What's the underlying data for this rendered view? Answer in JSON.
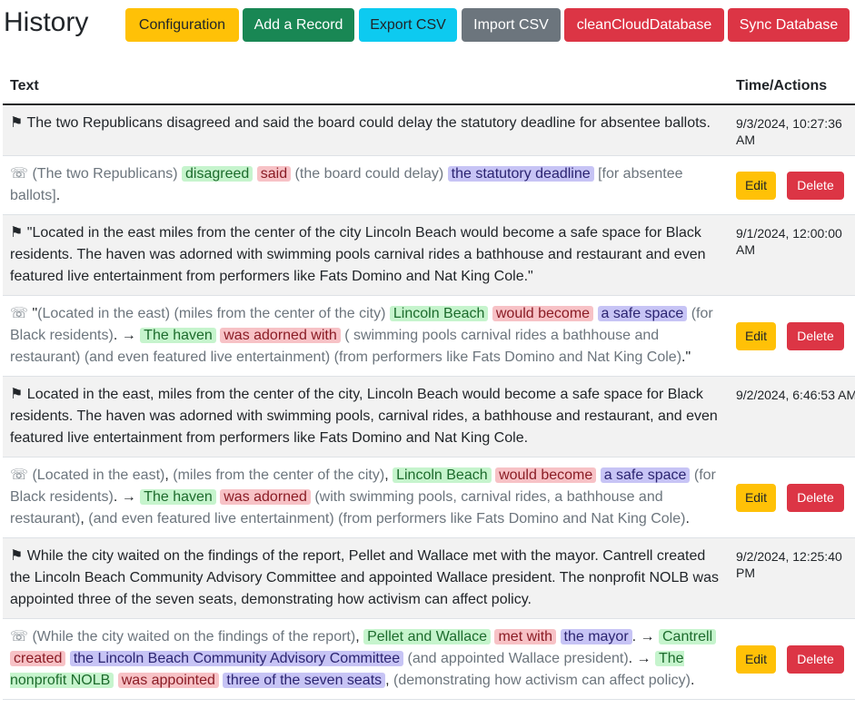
{
  "header": {
    "title": "History",
    "buttons": {
      "configuration": "Configuration",
      "add_record": "Add a Record",
      "export_csv": "Export CSV",
      "import_csv": "Import CSV",
      "clean_cloud_database": "cleanCloudDatabase",
      "sync_database": "Sync Database"
    }
  },
  "table": {
    "columns": {
      "text": "Text",
      "time_actions": "Time/Actions"
    },
    "actions": {
      "edit": "Edit",
      "delete": "Delete"
    },
    "flag_icon": "⚑",
    "phone_icon": "☏",
    "records": [
      {
        "sentence": "The two Republicans disagreed and said the board could delay the statutory deadline for absentee ballots.",
        "time": "9/3/2024, 10:27:36 AM",
        "parsed": [
          {
            "t": "(The two Republicans)",
            "c": "gray"
          },
          {
            "t": " ",
            "c": "plain"
          },
          {
            "t": "disagreed",
            "c": "green"
          },
          {
            "t": " ",
            "c": "plain"
          },
          {
            "t": "said",
            "c": "red"
          },
          {
            "t": " ",
            "c": "plain"
          },
          {
            "t": "(the board could delay)",
            "c": "gray"
          },
          {
            "t": " ",
            "c": "plain"
          },
          {
            "t": "the statutory deadline",
            "c": "purple"
          },
          {
            "t": " ",
            "c": "plain"
          },
          {
            "t": "[for absentee ballots]",
            "c": "gray"
          },
          {
            "t": ".",
            "c": "plain"
          }
        ]
      },
      {
        "sentence": "\"Located in the east miles from the center of the city Lincoln Beach would become a safe space for Black residents. The haven was adorned with swimming pools carnival rides a bathhouse and restaurant and even featured live entertainment from performers like Fats Domino and Nat King Cole.\"",
        "time": "9/1/2024, 12:00:00 AM",
        "parsed": [
          {
            "t": "\"",
            "c": "plain"
          },
          {
            "t": "(Located in the east)",
            "c": "gray"
          },
          {
            "t": " ",
            "c": "plain"
          },
          {
            "t": "(miles from the center of the city)",
            "c": "gray"
          },
          {
            "t": " ",
            "c": "plain"
          },
          {
            "t": "Lincoln Beach",
            "c": "green"
          },
          {
            "t": " ",
            "c": "plain"
          },
          {
            "t": "would become",
            "c": "red"
          },
          {
            "t": " ",
            "c": "plain"
          },
          {
            "t": "a safe space",
            "c": "purple"
          },
          {
            "t": " ",
            "c": "plain"
          },
          {
            "t": "(for Black residents)",
            "c": "gray"
          },
          {
            "t": ". → ",
            "c": "plain"
          },
          {
            "t": "The haven",
            "c": "green"
          },
          {
            "t": " ",
            "c": "plain"
          },
          {
            "t": "was adorned with",
            "c": "red"
          },
          {
            "t": " ",
            "c": "plain"
          },
          {
            "t": "( swimming pools carnival rides a bathhouse and restaurant)",
            "c": "gray"
          },
          {
            "t": " ",
            "c": "plain"
          },
          {
            "t": "(and even featured live entertainment)",
            "c": "gray"
          },
          {
            "t": " ",
            "c": "plain"
          },
          {
            "t": "(from performers like Fats Domino and Nat King Cole)",
            "c": "gray"
          },
          {
            "t": ".\"",
            "c": "plain"
          }
        ]
      },
      {
        "sentence": "Located in the east, miles from the center of the city, Lincoln Beach would become a safe space for Black residents. The haven was adorned with swimming pools, carnival rides, a bathhouse and restaurant, and even featured live entertainment from performers like Fats Domino and Nat King Cole.",
        "time": "9/2/2024, 6:46:53 AM",
        "parsed": [
          {
            "t": "(Located in the east)",
            "c": "gray"
          },
          {
            "t": ", ",
            "c": "plain"
          },
          {
            "t": "(miles from the center of the city)",
            "c": "gray"
          },
          {
            "t": ", ",
            "c": "plain"
          },
          {
            "t": "Lincoln Beach",
            "c": "green"
          },
          {
            "t": " ",
            "c": "plain"
          },
          {
            "t": "would become",
            "c": "red"
          },
          {
            "t": " ",
            "c": "plain"
          },
          {
            "t": "a safe space",
            "c": "purple"
          },
          {
            "t": " ",
            "c": "plain"
          },
          {
            "t": "(for Black residents)",
            "c": "gray"
          },
          {
            "t": ". → ",
            "c": "plain"
          },
          {
            "t": "The haven",
            "c": "green"
          },
          {
            "t": " ",
            "c": "plain"
          },
          {
            "t": "was adorned",
            "c": "red"
          },
          {
            "t": " ",
            "c": "plain"
          },
          {
            "t": "(with swimming pools, carnival rides, a bathhouse and restaurant)",
            "c": "gray"
          },
          {
            "t": ", ",
            "c": "plain"
          },
          {
            "t": "(and even featured live entertainment)",
            "c": "gray"
          },
          {
            "t": " ",
            "c": "plain"
          },
          {
            "t": "(from performers like Fats Domino and Nat King Cole)",
            "c": "gray"
          },
          {
            "t": ".",
            "c": "plain"
          }
        ]
      },
      {
        "sentence": "While the city waited on the findings of the report, Pellet and Wallace met with the mayor. Cantrell created the Lincoln Beach Community Advisory Committee and appointed Wallace president. The nonprofit NOLB was appointed three of the seven seats, demonstrating how activism can affect policy.",
        "time": "9/2/2024, 12:25:40 PM",
        "parsed": [
          {
            "t": "(While the city waited on the findings of the report)",
            "c": "gray"
          },
          {
            "t": ", ",
            "c": "plain"
          },
          {
            "t": "Pellet and Wallace",
            "c": "green"
          },
          {
            "t": " ",
            "c": "plain"
          },
          {
            "t": "met with",
            "c": "red"
          },
          {
            "t": " ",
            "c": "plain"
          },
          {
            "t": "the mayor",
            "c": "purple"
          },
          {
            "t": ". → ",
            "c": "plain"
          },
          {
            "t": "Cantrell",
            "c": "green"
          },
          {
            "t": " ",
            "c": "plain"
          },
          {
            "t": "created",
            "c": "red"
          },
          {
            "t": " ",
            "c": "plain"
          },
          {
            "t": "the Lincoln Beach Community Advisory Committee",
            "c": "purple"
          },
          {
            "t": " ",
            "c": "plain"
          },
          {
            "t": "(and appointed Wallace president)",
            "c": "gray"
          },
          {
            "t": ". → ",
            "c": "plain"
          },
          {
            "t": "The nonprofit NOLB",
            "c": "green"
          },
          {
            "t": " ",
            "c": "plain"
          },
          {
            "t": "was appointed",
            "c": "red"
          },
          {
            "t": " ",
            "c": "plain"
          },
          {
            "t": "three of the seven seats",
            "c": "purple"
          },
          {
            "t": ", ",
            "c": "plain"
          },
          {
            "t": "(demonstrating how activism can affect policy)",
            "c": "gray"
          },
          {
            "t": ".",
            "c": "plain"
          }
        ]
      }
    ]
  },
  "colors": {
    "configuration": "#ffc107",
    "add_record": "#198754",
    "export_csv": "#0dcaf0",
    "import_csv": "#6c757d",
    "danger": "#dc3545",
    "highlight_green": "#c6f4cd",
    "highlight_red": "#f7c2c6",
    "highlight_purple": "#c7c4f5"
  }
}
